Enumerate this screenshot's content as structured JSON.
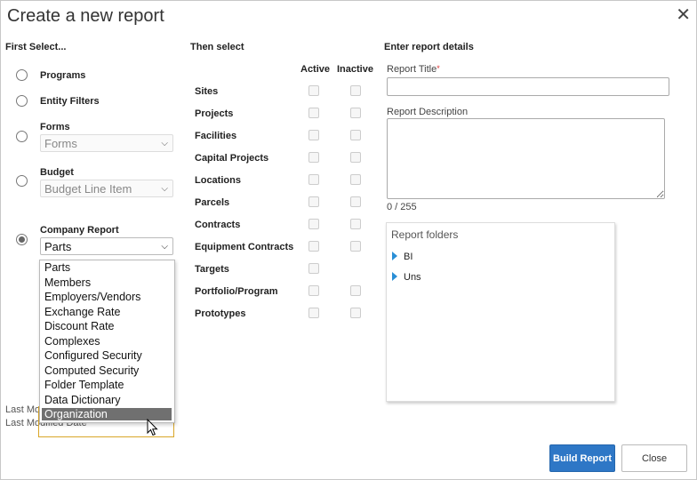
{
  "dialog": {
    "title": "Create a new report",
    "close_icon": "close-icon"
  },
  "column_headers": {
    "first": "First Select...",
    "then": "Then select",
    "details": "Enter report details"
  },
  "first_select": {
    "programs": "Programs",
    "entity_filters": "Entity Filters",
    "forms": {
      "label": "Forms",
      "value": "Forms"
    },
    "budget": {
      "label": "Budget",
      "value": "Budget Line Item"
    },
    "company_report": {
      "label": "Company Report",
      "value": "Parts"
    },
    "selected_option": "company_report"
  },
  "dropdown": {
    "options": [
      "Parts",
      "Members",
      "Employers/Vendors",
      "Exchange Rate",
      "Discount Rate",
      "Complexes",
      "Configured Security",
      "Computed Security",
      "Folder Template",
      "Data Dictionary",
      "Organization"
    ],
    "highlighted": "Organization"
  },
  "behind_text": {
    "last_modified_by": "Last Modified By",
    "last_modified_date": "Last Modified Date"
  },
  "then_select": {
    "active_header": "Active",
    "inactive_header": "Inactive",
    "entities": [
      {
        "name": "Sites",
        "inactive_box": true
      },
      {
        "name": "Projects",
        "inactive_box": true
      },
      {
        "name": "Facilities",
        "inactive_box": true
      },
      {
        "name": "Capital Projects",
        "inactive_box": true
      },
      {
        "name": "Locations",
        "inactive_box": true
      },
      {
        "name": "Parcels",
        "inactive_box": true
      },
      {
        "name": "Contracts",
        "inactive_box": true
      },
      {
        "name": "Equipment Contracts",
        "inactive_box": true
      },
      {
        "name": "Targets",
        "inactive_box": false
      },
      {
        "name": "Portfolio/Program",
        "inactive_box": true
      },
      {
        "name": "Prototypes",
        "inactive_box": true
      }
    ]
  },
  "details": {
    "title_label": "Report Title",
    "required_mark": "*",
    "title_value": "",
    "description_label": "Report Description",
    "description_value": "",
    "char_count": "0 / 255",
    "folders_title": "Report folders",
    "folders": [
      "BI",
      "Uns"
    ]
  },
  "buttons": {
    "build": "Build Report",
    "close": "Close"
  },
  "colors": {
    "primary": "#2e77c6",
    "folder_arrow": "#2a8fd6",
    "focus_border": "#d9a628",
    "required": "#dd3333"
  }
}
